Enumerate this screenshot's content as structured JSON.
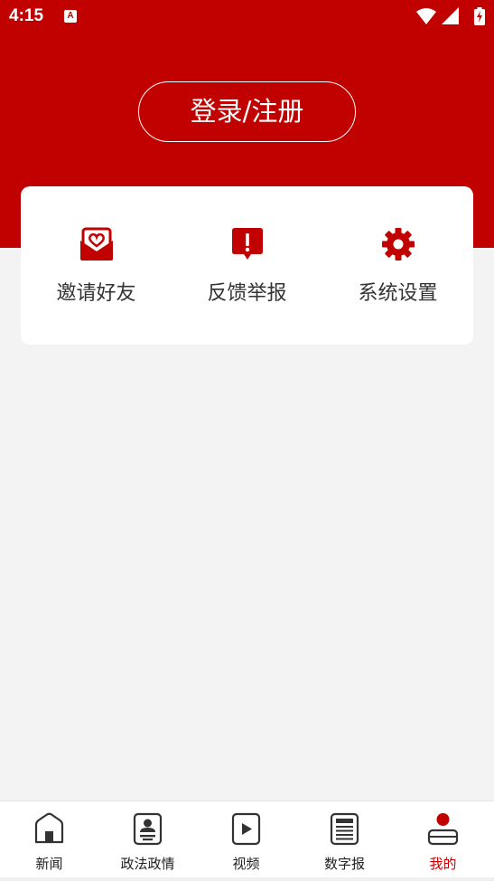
{
  "status_bar": {
    "time": "4:15",
    "app_badge": "A"
  },
  "header": {
    "login_label": "登录/注册"
  },
  "quick_actions": [
    {
      "label": "邀请好友",
      "icon": "envelope-heart-icon"
    },
    {
      "label": "反馈举报",
      "icon": "report-alert-icon"
    },
    {
      "label": "系统设置",
      "icon": "gear-icon"
    }
  ],
  "tabbar": {
    "items": [
      {
        "label": "新闻",
        "icon": "home-icon",
        "active": false
      },
      {
        "label": "政法政情",
        "icon": "id-card-icon",
        "active": false
      },
      {
        "label": "视频",
        "icon": "play-icon",
        "active": false
      },
      {
        "label": "数字报",
        "icon": "newspaper-icon",
        "active": false
      },
      {
        "label": "我的",
        "icon": "profile-icon",
        "active": true
      }
    ]
  },
  "colors": {
    "brand": "#c10000",
    "background": "#f3f3f3",
    "text": "#333333"
  }
}
